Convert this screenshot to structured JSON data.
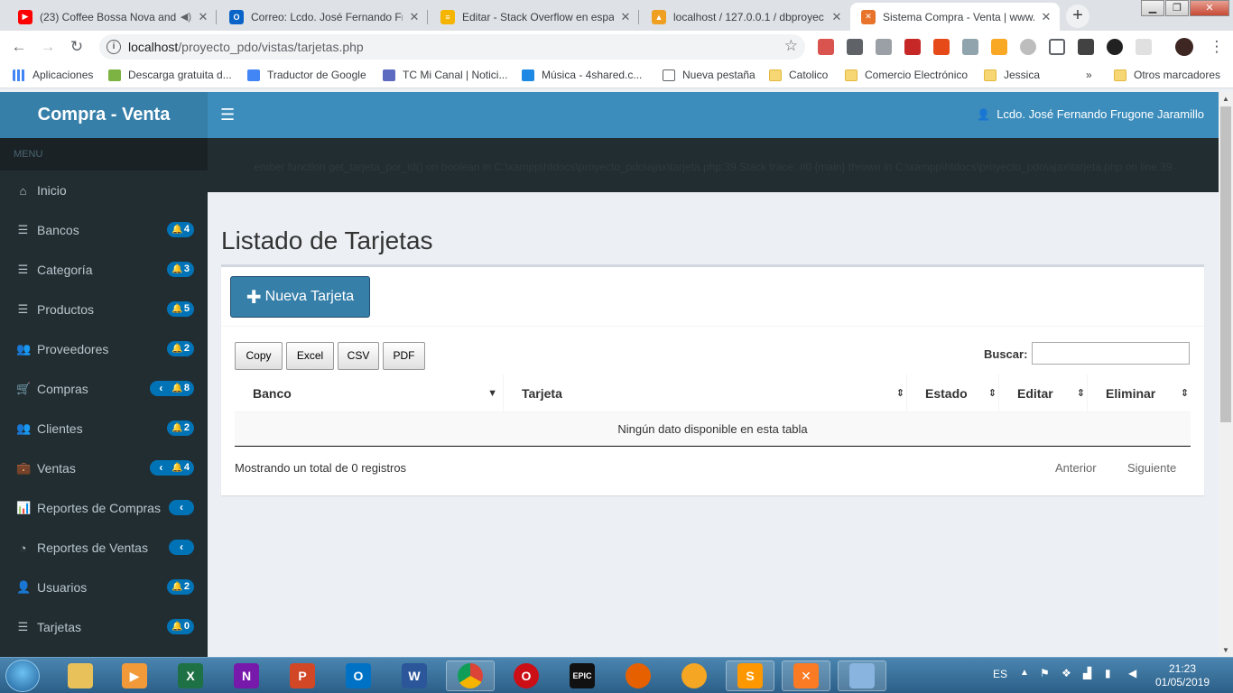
{
  "browser": {
    "tabs": [
      {
        "title": "(23) Coffee Bossa Nova and",
        "color": "#ff0000",
        "icon": "youtube-icon"
      },
      {
        "title": "Correo: Lcdo. José Fernando Fru",
        "color": "#0a64c8",
        "icon": "outlook-icon"
      },
      {
        "title": "Editar - Stack Overflow en espa",
        "color": "#f48024",
        "icon": "stackoverflow-icon"
      },
      {
        "title": "localhost / 127.0.0.1 / dbproyec",
        "color": "#f0a020",
        "icon": "phpmyadmin-icon"
      },
      {
        "title": "Sistema Compra - Venta | www.",
        "color": "#e8742c",
        "icon": "xampp-icon"
      }
    ],
    "url_host": "localhost",
    "url_path": "/proyecto_pdo/vistas/tarjetas.php",
    "bookmarks": [
      {
        "label": "Aplicaciones"
      },
      {
        "label": "Descarga gratuita d..."
      },
      {
        "label": "Traductor de Google"
      },
      {
        "label": "TC Mi Canal | Notici..."
      },
      {
        "label": "Música - 4shared.c..."
      },
      {
        "label": "Nueva pestaña"
      },
      {
        "label": "Catolico"
      },
      {
        "label": "Comercio Electrónico"
      },
      {
        "label": "Jessica"
      },
      {
        "label": "Otros marcadores"
      }
    ],
    "bookmarks_more": "»"
  },
  "app": {
    "logo": "Compra - Venta",
    "menu_header": "MENU",
    "user_name": "Lcdo. José Fernando Frugone Jaramillo",
    "error_text": "ember function get_tarjeta_por_id() on boolean in C:\\xampp\\htdocs\\proyecto_pdo\\ajax\\tarjeta.php:39 Stack trace: #0 {main} thrown in C:\\xampp\\htdocs\\proyecto_pdo\\ajax\\tarjeta.php on line 39",
    "nav": [
      {
        "label": "Inicio",
        "icon": "home-icon"
      },
      {
        "label": "Bancos",
        "icon": "list-icon",
        "badge": "4"
      },
      {
        "label": "Categoría",
        "icon": "list-icon",
        "badge": "3"
      },
      {
        "label": "Productos",
        "icon": "list-icon",
        "badge": "5"
      },
      {
        "label": "Proveedores",
        "icon": "users-icon",
        "badge": "2"
      },
      {
        "label": "Compras",
        "icon": "cart-icon",
        "badge": "8",
        "chevron": true
      },
      {
        "label": "Clientes",
        "icon": "users-icon",
        "badge": "2"
      },
      {
        "label": "Ventas",
        "icon": "briefcase-icon",
        "badge": "4",
        "chevron": true
      },
      {
        "label": "Reportes de Compras",
        "icon": "bar-chart-icon",
        "chevron": true
      },
      {
        "label": "Reportes de Ventas",
        "icon": "pie-chart-icon",
        "chevron": true
      },
      {
        "label": "Usuarios",
        "icon": "user-icon",
        "badge": "2"
      },
      {
        "label": "Tarjetas",
        "icon": "list-icon",
        "badge": "0"
      }
    ],
    "page_title": "Listado de Tarjetas",
    "new_button": "Nueva Tarjeta",
    "export_buttons": [
      "Copy",
      "Excel",
      "CSV",
      "PDF"
    ],
    "search_label": "Buscar:",
    "table": {
      "columns": [
        "Banco",
        "Tarjeta",
        "Estado",
        "Editar",
        "Eliminar"
      ],
      "empty_text": "Ningún dato disponible en esta tabla"
    },
    "info_text": "Mostrando un total de 0 registros",
    "prev": "Anterior",
    "next": "Siguiente"
  },
  "taskbar": {
    "language": "ES",
    "time": "21:23",
    "date": "01/05/2019"
  },
  "colors": {
    "sidebar": "#222d32",
    "header": "#3c8dbc",
    "logo": "#367fa9",
    "badge": "#0073b7"
  }
}
